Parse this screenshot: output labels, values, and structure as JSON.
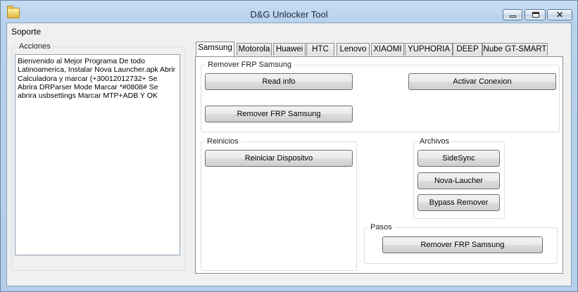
{
  "window": {
    "title": "D&G Unlocker Tool"
  },
  "menu": {
    "items": [
      "Soporte"
    ]
  },
  "acciones": {
    "label": "Acciones",
    "text": "Bienvenido al Mejor Programa De todo Latinoamerica, Instalar Nova Launcher.apk  Abrir Calculadora y marcar (+30012012732+  Se Abrira DRParser Mode Marcar *#0808# Se abrira usbsettings Marcar MTP+ADB Y OK"
  },
  "tabs": [
    "Samsung",
    "Motorola",
    "Huawei",
    "HTC",
    "Lenovo",
    "XIAOMI",
    "YUPHORIA",
    "DEEP",
    "Nube GT-SMART"
  ],
  "samsung": {
    "frp_group": {
      "label": "Remover FRP Samsung",
      "read_info": "Read info",
      "activar": "Activar Conexion",
      "remover": "Remover FRP Samsung"
    },
    "reinicios": {
      "label": "Reinicios",
      "reiniciar": "Reiniciar Dispositvo"
    },
    "archivos": {
      "label": "Archivos",
      "sidesync": "SideSync",
      "nova": "Nova-Laucher",
      "bypass": "Bypass Remover"
    },
    "pasos": {
      "label": "Pasos",
      "remover": "Remover FRP Samsung"
    }
  }
}
